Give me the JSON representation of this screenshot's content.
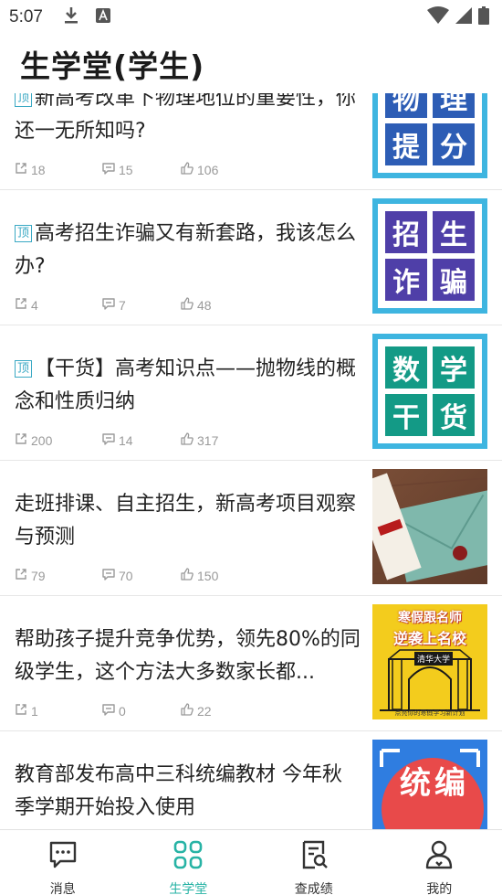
{
  "status_bar": {
    "time": "5:07",
    "icons": [
      "download-icon",
      "a-badge-icon",
      "wifi-icon",
      "signal-icon",
      "battery-icon"
    ]
  },
  "header": {
    "title": "生学堂(学生)"
  },
  "colors": {
    "accent": "#27b3a5",
    "tile_blue_frame": "#3eb5e0",
    "tile_purple": "#4f3fa8",
    "tile_teal": "#139a86",
    "meta_gray": "#9a9a9a"
  },
  "articles": [
    {
      "pinned": true,
      "pin_label": "顶",
      "title": "新高考改革下物理地位的重要性，你还一无所知吗?",
      "shares": "18",
      "comments": "15",
      "likes": "106",
      "thumb": {
        "type": "tile",
        "chars": [
          "物",
          "理",
          "提",
          "分"
        ]
      }
    },
    {
      "pinned": true,
      "pin_label": "顶",
      "title": "高考招生诈骗又有新套路，我该怎么办?",
      "shares": "4",
      "comments": "7",
      "likes": "48",
      "thumb": {
        "type": "tile",
        "chars": [
          "招",
          "生",
          "诈",
          "骗"
        ]
      }
    },
    {
      "pinned": true,
      "pin_label": "顶",
      "title": "【干货】高考知识点——抛物线的概念和性质归纳",
      "shares": "200",
      "comments": "14",
      "likes": "317",
      "thumb": {
        "type": "tile",
        "chars": [
          "数",
          "学",
          "干",
          "货"
        ]
      }
    },
    {
      "pinned": false,
      "pin_label": "",
      "title": "走班排课、自主招生，新高考项目观察与预测",
      "shares": "79",
      "comments": "70",
      "likes": "150",
      "thumb": {
        "type": "photo-envelope"
      }
    },
    {
      "pinned": false,
      "pin_label": "",
      "title": "帮助孩子提升竞争优势，领先80%的同级学生，这个方法大多数家长都...",
      "shares": "1",
      "comments": "0",
      "likes": "22",
      "thumb": {
        "type": "poster",
        "line1": "寒假跟名师",
        "line2": "逆袭上名校",
        "gate_text": "清华大学",
        "footer": "点亮你的寒假学习新计划"
      }
    },
    {
      "pinned": false,
      "pin_label": "",
      "title": "教育部发布高中三科统编教材 今年秋季学期开始投入使用",
      "shares": "",
      "comments": "",
      "likes": "",
      "thumb": {
        "type": "partial",
        "chars": [
          "统",
          "编"
        ]
      }
    }
  ],
  "bottom_nav": {
    "items": [
      {
        "label": "消息",
        "icon": "message-icon",
        "active": false
      },
      {
        "label": "生学堂",
        "icon": "grid-icon",
        "active": true
      },
      {
        "label": "查成绩",
        "icon": "search-doc-icon",
        "active": false
      },
      {
        "label": "我的",
        "icon": "profile-icon",
        "active": false
      }
    ]
  }
}
